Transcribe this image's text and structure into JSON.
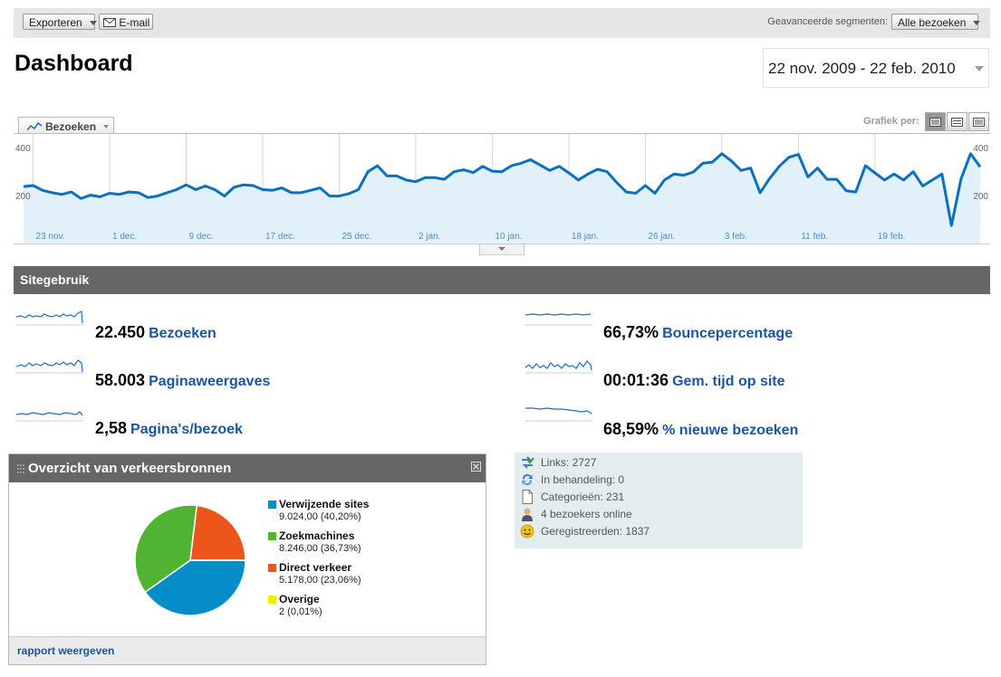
{
  "toolbar": {
    "export_label": "Exporteren",
    "email_label": "E-mail",
    "segments_label": "Geavanceerde segmenten:",
    "segments_value": "Alle bezoeken"
  },
  "header": {
    "title": "Dashboard",
    "date_range": "22 nov. 2009 - 22 feb. 2010"
  },
  "main_chart": {
    "metric_label": "Bezoeken",
    "graph_per_label": "Grafiek per:",
    "view_options": [
      "dag",
      "week",
      "maand"
    ],
    "accent_color": "#0b6fc2",
    "fill_color": "#e2f0f9"
  },
  "chart_data": {
    "type": "area",
    "yticks": [
      "400",
      "200"
    ],
    "ylim": [
      0,
      450
    ],
    "xticks": [
      "23 nov.",
      "1 dec.",
      "9 dec.",
      "17 dec.",
      "25 dec.",
      "2 jan.",
      "10 jan.",
      "18 jan.",
      "26 jan.",
      "3 feb.",
      "11 feb.",
      "19 feb."
    ],
    "x_start": "2009-11-22",
    "values": [
      238,
      242,
      222,
      212,
      205,
      215,
      188,
      202,
      195,
      210,
      205,
      215,
      212,
      192,
      198,
      212,
      225,
      245,
      225,
      240,
      225,
      198,
      235,
      245,
      242,
      225,
      222,
      232,
      212,
      212,
      222,
      232,
      198,
      198,
      208,
      225,
      300,
      325,
      282,
      282,
      265,
      258,
      275,
      275,
      268,
      300,
      308,
      296,
      322,
      302,
      300,
      325,
      335,
      350,
      328,
      305,
      322,
      295,
      265,
      290,
      310,
      300,
      255,
      215,
      210,
      242,
      210,
      265,
      290,
      285,
      298,
      335,
      340,
      375,
      345,
      305,
      315,
      212,
      272,
      322,
      360,
      372,
      278,
      315,
      268,
      268,
      220,
      215,
      325,
      295,
      265,
      290,
      265,
      300,
      240,
      265,
      290,
      75,
      270,
      375,
      320
    ],
    "series": [
      {
        "name": "Bezoeken"
      }
    ]
  },
  "site_usage": {
    "title": "Sitegebruik",
    "metrics": [
      {
        "value": "22.450",
        "label": "Bezoeken"
      },
      {
        "value": "58.003",
        "label": "Paginaweergaves"
      },
      {
        "value": "2,58",
        "label": "Pagina's/bezoek"
      },
      {
        "value": "66,73%",
        "label": "Bouncepercentage"
      },
      {
        "value": "00:01:36",
        "label": "Gem. tijd op site"
      },
      {
        "value": "68,59%",
        "label": "% nieuwe bezoeken"
      }
    ]
  },
  "traffic_sources": {
    "title": "Overzicht van verkeersbronnen",
    "footer_link": "rapport weergeven",
    "slices": [
      {
        "name": "Verwijzende sites",
        "value": 9024,
        "detail": "9.024,00 (40,20%)",
        "color": "#058dc7"
      },
      {
        "name": "Zoekmachines",
        "value": 8246,
        "detail": "8.246,00 (36,73%)",
        "color": "#50b432"
      },
      {
        "name": "Direct verkeer",
        "value": 5178,
        "detail": "5.178,00 (23,06%)",
        "color": "#ed561b"
      },
      {
        "name": "Overige",
        "value": 2,
        "detail": "2 (0,01%)",
        "color": "#edef00"
      }
    ]
  },
  "forum_stats": [
    {
      "icon": "links-icon",
      "text": "Links: 2727"
    },
    {
      "icon": "pending-icon",
      "text": "In behandeling: 0"
    },
    {
      "icon": "categories-icon",
      "text": "Categorieën: 231"
    },
    {
      "icon": "visitors-online-icon",
      "text": "4 bezoekers online"
    },
    {
      "icon": "registered-icon",
      "text": "Geregistreerden: 1837"
    }
  ]
}
